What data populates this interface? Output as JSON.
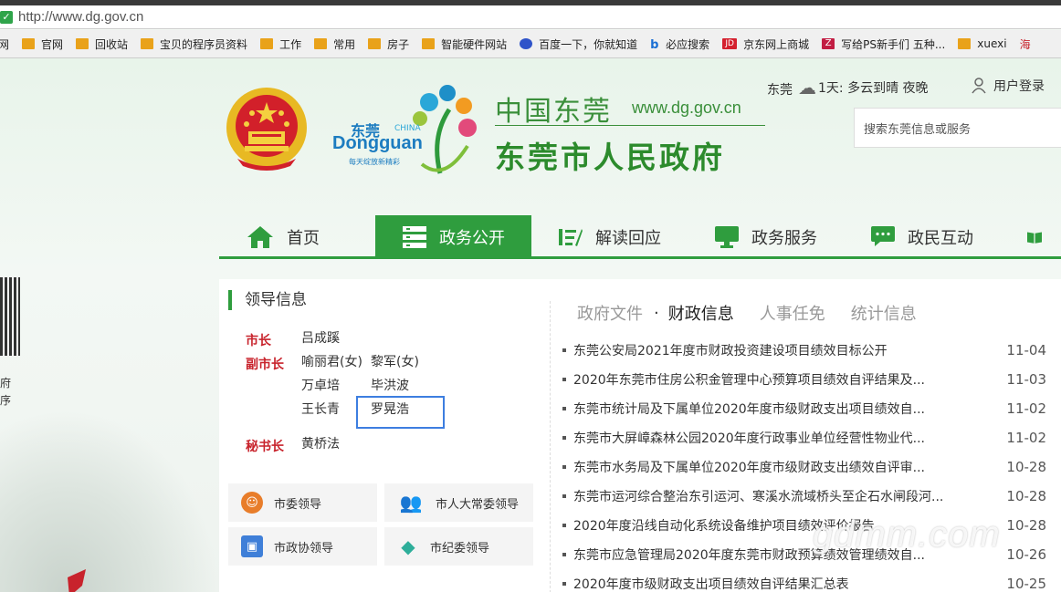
{
  "browser": {
    "url": "http://www.dg.gov.cn",
    "bookmarks": [
      {
        "label": "网",
        "icon": "none"
      },
      {
        "label": "官网",
        "icon": "folder-icon"
      },
      {
        "label": "回收站",
        "icon": "folder-icon"
      },
      {
        "label": "宝贝的程序员资料",
        "icon": "folder-icon"
      },
      {
        "label": "工作",
        "icon": "folder-icon"
      },
      {
        "label": "常用",
        "icon": "folder-icon"
      },
      {
        "label": "房子",
        "icon": "folder-icon"
      },
      {
        "label": "智能硬件网站",
        "icon": "folder-icon"
      },
      {
        "label": "百度一下，你就知道",
        "icon": "baidu-icon"
      },
      {
        "label": "必应搜索",
        "icon": "bing-icon"
      },
      {
        "label": "京东网上商城",
        "icon": "jd-icon"
      },
      {
        "label": "写给PS新手们 五种...",
        "icon": "zhihu-icon"
      },
      {
        "label": "xuexi",
        "icon": "folder-icon"
      },
      {
        "label": "海",
        "icon": "none"
      }
    ]
  },
  "header": {
    "logo_en_top": "东莞",
    "logo_en_china": "CHINA",
    "logo_en": "Dongguan",
    "logo_slogan": "每天绽放新精彩",
    "title_cn": "中国东莞",
    "site_url": "www.dg.gov.cn",
    "title_gov": "东莞市人民政府",
    "weather_city": "东莞",
    "weather_text": "1天: 多云到晴 夜晚",
    "login_label": "用户登录",
    "search_placeholder": "搜索东莞信息或服务"
  },
  "nav": {
    "items": [
      {
        "label": "首页",
        "icon": "home-icon"
      },
      {
        "label": "政务公开",
        "icon": "list-icon",
        "active": true
      },
      {
        "label": "解读回应",
        "icon": "interpret-icon"
      },
      {
        "label": "政务服务",
        "icon": "monitor-icon"
      },
      {
        "label": "政民互动",
        "icon": "chat-icon"
      }
    ]
  },
  "leaders": {
    "title": "领导信息",
    "mayor_label": "市长",
    "mayor": "吕成蹊",
    "vice_label": "副市长",
    "vice": [
      "喻丽君(女)",
      "黎军(女)",
      "万卓培",
      "毕洪波",
      "王长青",
      "罗晃浩"
    ],
    "secretary_label": "秘书长",
    "secretary": "黄桥法"
  },
  "cards": [
    {
      "label": "市委领导",
      "icon": "person-icon",
      "color": "#e87d2a"
    },
    {
      "label": "市人大常委领导",
      "icon": "people-icon",
      "color": "#3aa047"
    },
    {
      "label": "市政协领导",
      "icon": "badge-icon",
      "color": "#3f7fd8"
    },
    {
      "label": "市纪委领导",
      "icon": "layers-icon",
      "color": "#2eae9a"
    }
  ],
  "tabs": {
    "items": [
      "政府文件",
      "财政信息",
      "人事任免",
      "统计信息"
    ],
    "separator": "·",
    "active": "财政信息"
  },
  "news": [
    {
      "title": "东莞公安局2021年度市财政投资建设项目绩效目标公开",
      "date": "11-04"
    },
    {
      "title": "2020年东莞市住房公积金管理中心预算项目绩效自评结果及...",
      "date": "11-03"
    },
    {
      "title": "东莞市统计局及下属单位2020年度市级财政支出项目绩效自...",
      "date": "11-02"
    },
    {
      "title": "东莞市大屏嶂森林公园2020年度行政事业单位经营性物业代...",
      "date": "11-02"
    },
    {
      "title": "东莞市水务局及下属单位2020年度市级财政支出绩效自评审...",
      "date": "10-28"
    },
    {
      "title": "东莞市运河综合整治东引运河、寒溪水流域桥头至企石水闸段河...",
      "date": "10-28"
    },
    {
      "title": "2020年度沿线自动化系统设备维护项目绩效评价报告",
      "date": "10-28"
    },
    {
      "title": "东莞市应急管理局2020年度东莞市财政预算绩效管理绩效自...",
      "date": "10-26"
    },
    {
      "title": "2020年度市级财政支出项目绩效自评结果汇总表",
      "date": "10-25"
    }
  ],
  "side": {
    "qr_label_1": "府",
    "qr_label_2": "序"
  },
  "watermark": "gdmm.com"
}
